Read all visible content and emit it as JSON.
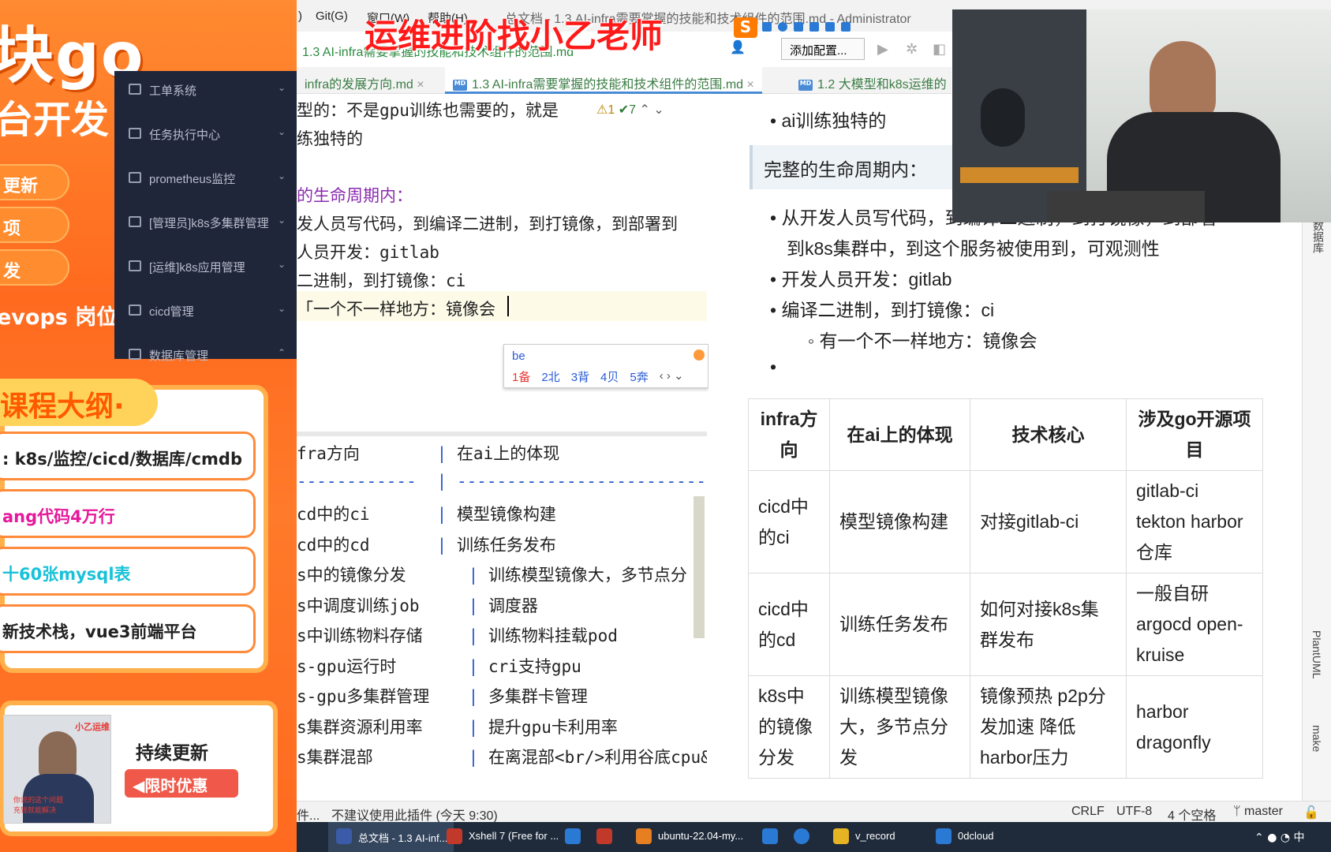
{
  "promo": {
    "brand": "块go",
    "brand2": "台开发",
    "pills": [
      "更新",
      "项",
      "发"
    ],
    "devops": "evops 岗位",
    "menu": [
      {
        "label": "工单系统"
      },
      {
        "label": "任务执行中心"
      },
      {
        "label": "prometheus监控"
      },
      {
        "label": "[管理员]k8s多集群管理"
      },
      {
        "label": "[运维]k8s应用管理"
      },
      {
        "label": "cicd管理"
      },
      {
        "label": "数据库管理"
      }
    ],
    "outline_title": "课程大纲·",
    "outline_items": [
      {
        "text": ": k8s/监控/cicd/数据库/cmdb",
        "color": "#222222"
      },
      {
        "text": "ang代码4万行",
        "color": "#e6199b"
      },
      {
        "text": "十60张mysql表",
        "color": "#19c2d9"
      },
      {
        "text": "新技术栈，vue3前端平台",
        "color": "#222222"
      }
    ],
    "card_title": "持续更新",
    "card_button": "◀限时优惠",
    "thumb_tag": "小乙运维",
    "thumb_caption1": "你说的这个问题",
    "thumb_caption2": "充钱就能解决"
  },
  "ide": {
    "menu_items": [
      ")",
      "Git(G)",
      "窗口(W)",
      "帮助(H)"
    ],
    "window_title": "总文档 - 1.3 AI-infra需要掌握的技能和技术组件的范围.md - Administrator",
    "watermark": "运维进阶找小乙老师",
    "path": "1.3 AI-infra需要掌握的技能和技术组件的范围.md",
    "add_config": "添加配置...",
    "tabs": [
      {
        "label": "infra的发展方向.md"
      },
      {
        "label": "1.3 AI-infra需要掌握的技能和技术组件的范围.md"
      },
      {
        "label": "1.2 大模型和k8s运维的"
      }
    ],
    "inspection": {
      "warn": "1",
      "ok": "7"
    },
    "editor_lines": [
      {
        "text": "型的：不是gpu训练也需要的，就是",
        "kind": "plain"
      },
      {
        "text": "练独特的",
        "kind": "plain"
      },
      {
        "text": "",
        "kind": "plain"
      },
      {
        "text": "的生命周期内：",
        "kind": "purple"
      },
      {
        "text": "发人员写代码，到编译二进制，到打镜像，到部署到",
        "kind": "plain"
      },
      {
        "text": "人员开发：gitlab",
        "kind": "plain"
      },
      {
        "text": "二进制，到打镜像：ci",
        "kind": "plain"
      },
      {
        "text": "「一个不一样地方：镜像会",
        "kind": "plain"
      }
    ],
    "ime": {
      "input": "be",
      "candidates": [
        "1备",
        "2北",
        "3背",
        "4贝",
        "5奔"
      ]
    },
    "table_lines": [
      {
        "a": "fra方向",
        "b": "在ai上的体现"
      },
      {
        "a": "------------",
        "b": "-----------------------------"
      },
      {
        "a": "cd中的ci",
        "b": "模型镜像构建"
      },
      {
        "a": "cd中的cd",
        "b": "训练任务发布"
      },
      {
        "a": "s中的镜像分发",
        "b": "训练模型镜像大，多节点分"
      },
      {
        "a": "s中调度训练job",
        "b": "调度器"
      },
      {
        "a": "s中训练物料存储",
        "b": "训练物料挂载pod"
      },
      {
        "a": "s-gpu运行时",
        "b": "cri支持gpu"
      },
      {
        "a": "s-gpu多集群管理",
        "b": "多集群卡管理"
      },
      {
        "a": "s集群资源利用率",
        "b": "提升gpu卡利用率"
      },
      {
        "a": "s集群混部",
        "b": "在离混部<br/>利用谷底cpu&"
      }
    ],
    "preview": {
      "bullet_top": "ai训练独特的",
      "quote": "完整的生命周期内：",
      "bullets": [
        "从开发人员写代码，到编译二进制，到打镜像，到部署",
        "到k8s集群中，到这个服务被使用到，可观测性",
        "开发人员开发：gitlab",
        "编译二进制，到打镜像：ci"
      ],
      "sub_bullet": "有一个不一样地方：镜像会",
      "table_headers": [
        "infra方向",
        "在ai上的体现",
        "技术核心",
        "涉及go开源项目"
      ],
      "table_rows": [
        [
          "cicd中的ci",
          "模型镜像构建",
          "对接gitlab-ci",
          "gitlab-ci tekton harbor仓库"
        ],
        [
          "cicd中的cd",
          "训练任务发布",
          "如何对接k8s集群发布",
          "一般自研 argocd open-kruise"
        ],
        [
          "k8s中的镜像分发",
          "训练模型镜像大，多节点分发",
          "镜像预热 p2p分发加速 降低harbor压力",
          "harbor dragonfly"
        ]
      ]
    },
    "right_tools": [
      "数据库",
      "PlantUML",
      "make"
    ],
    "status": {
      "left": "件...",
      "plugin": "不建议使用此插件 (今天 9:30)",
      "crlf": "CRLF",
      "encoding": "UTF-8",
      "indent": "4 个空格",
      "branch": "master"
    },
    "taskbar": [
      {
        "label": "总文档 - 1.3 AI-inf...",
        "color": "#3b5ba9"
      },
      {
        "label": "Xshell 7 (Free for ...",
        "color": "#c0392b"
      },
      {
        "label": "",
        "color": "#2a7ad5"
      },
      {
        "label": "",
        "color": "#c0392b"
      },
      {
        "label": "ubuntu-22.04-my...",
        "color": "#e67e22"
      },
      {
        "label": "",
        "color": "#2a7ad5"
      },
      {
        "label": "",
        "color": "#2a7ad5"
      },
      {
        "label": "v_record",
        "color": "#e6b422"
      },
      {
        "label": "0dcloud",
        "color": "#2a7ad5"
      }
    ],
    "tray": "中"
  }
}
